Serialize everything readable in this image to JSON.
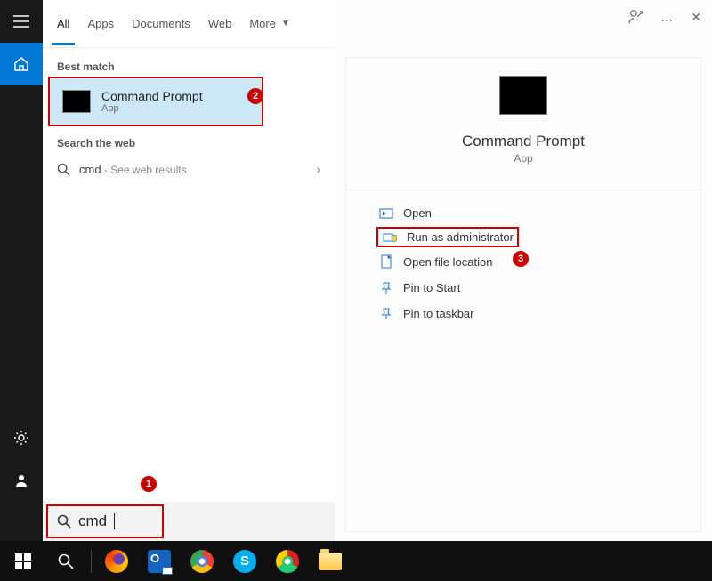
{
  "rail": {
    "menu": "menu",
    "home": "home",
    "settings": "settings",
    "account": "account"
  },
  "tabs": {
    "all": "All",
    "apps": "Apps",
    "documents": "Documents",
    "web": "Web",
    "more": "More"
  },
  "top_right": {
    "feedback": "feedback-icon",
    "more": "…",
    "close": "✕"
  },
  "sections": {
    "best_match": "Best match",
    "search_web": "Search the web"
  },
  "best_match": {
    "title": "Command Prompt",
    "subtitle": "App"
  },
  "web_result": {
    "query": "cmd",
    "suffix": " - See web results"
  },
  "preview": {
    "title": "Command Prompt",
    "subtitle": "App"
  },
  "actions": {
    "open": "Open",
    "run_admin": "Run as administrator",
    "open_loc": "Open file location",
    "pin_start": "Pin to Start",
    "pin_taskbar": "Pin to taskbar"
  },
  "searchbox": {
    "query": "cmd"
  },
  "annotations": {
    "b1": "1",
    "b2": "2",
    "b3": "3"
  },
  "taskbar_icons": {
    "start": "start-icon",
    "search": "search-icon",
    "firefox": "firefox-icon",
    "outlook": "outlook-icon",
    "chrome": "chrome-icon",
    "skype": "skype-icon",
    "chrome_canary": "chrome-canary-icon",
    "explorer": "file-explorer-icon"
  }
}
